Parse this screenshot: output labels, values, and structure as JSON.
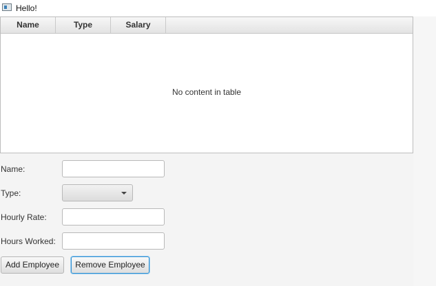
{
  "window": {
    "title": "Hello!"
  },
  "table": {
    "columns": [
      "Name",
      "Type",
      "Salary"
    ],
    "placeholder": "No content in table",
    "rows": []
  },
  "form": {
    "name_label": "Name:",
    "name_value": "",
    "type_label": "Type:",
    "type_value": "",
    "hourly_rate_label": "Hourly Rate:",
    "hourly_rate_value": "",
    "hours_worked_label": "Hours Worked:",
    "hours_worked_value": ""
  },
  "buttons": {
    "add_label": "Add Employee",
    "remove_label": "Remove Employee"
  },
  "icons": {
    "app": "app-window-icon",
    "dropdown": "chevron-down-icon"
  },
  "colors": {
    "focus_border": "#2f8fd1",
    "background": "#f4f4f4"
  }
}
